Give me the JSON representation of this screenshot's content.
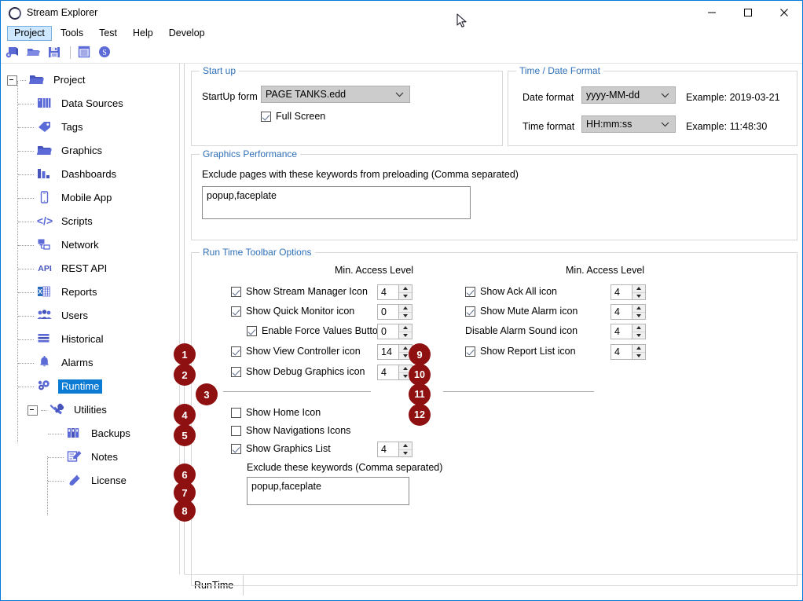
{
  "window": {
    "title": "Stream Explorer",
    "icon": "app-ring-icon",
    "minimize": "─",
    "maximize": "□",
    "close": "✕"
  },
  "menubar": {
    "items": [
      {
        "label": "Project",
        "active": true
      },
      {
        "label": "Tools",
        "active": false
      },
      {
        "label": "Test",
        "active": false
      },
      {
        "label": "Help",
        "active": false
      },
      {
        "label": "Develop",
        "active": false
      }
    ]
  },
  "toolbar": {
    "icons": [
      "new-project-icon",
      "open-folder-icon",
      "save-disk-icon",
      "separator",
      "list-view-icon",
      "s-circle-icon"
    ]
  },
  "sidebar": {
    "items": [
      {
        "label": "Project",
        "icon": "folder-icon",
        "level": 0,
        "expander": true,
        "selected": false
      },
      {
        "label": "Data Sources",
        "icon": "database-icon",
        "level": 1,
        "expander": false,
        "selected": false
      },
      {
        "label": "Tags",
        "icon": "tag-icon",
        "level": 1,
        "expander": false,
        "selected": false
      },
      {
        "label": "Graphics",
        "icon": "folder-icon",
        "level": 1,
        "expander": false,
        "selected": false
      },
      {
        "label": "Dashboards",
        "icon": "bar-chart-icon",
        "level": 1,
        "expander": false,
        "selected": false
      },
      {
        "label": "Mobile App",
        "icon": "phone-icon",
        "level": 1,
        "expander": false,
        "selected": false
      },
      {
        "label": "Scripts",
        "icon": "code-brackets-icon",
        "level": 1,
        "expander": false,
        "selected": false
      },
      {
        "label": "Network",
        "icon": "network-icon",
        "level": 1,
        "expander": false,
        "selected": false
      },
      {
        "label": "REST API",
        "icon": "api-text-icon",
        "level": 1,
        "expander": false,
        "selected": false
      },
      {
        "label": "Reports",
        "icon": "excel-icon",
        "level": 1,
        "expander": false,
        "selected": false
      },
      {
        "label": "Users",
        "icon": "users-icon",
        "level": 1,
        "expander": false,
        "selected": false
      },
      {
        "label": "Historical",
        "icon": "history-lines-icon",
        "level": 1,
        "expander": false,
        "selected": false
      },
      {
        "label": "Alarms",
        "icon": "bell-icon",
        "level": 1,
        "expander": false,
        "selected": false
      },
      {
        "label": "Runtime",
        "icon": "gears-icon",
        "level": 1,
        "expander": false,
        "selected": true
      },
      {
        "label": "Utilities",
        "icon": "tools-icon",
        "level": 1,
        "expander": true,
        "selected": false
      },
      {
        "label": "Backups",
        "icon": "backups-icon",
        "level": 2,
        "expander": false,
        "selected": false
      },
      {
        "label": "Notes",
        "icon": "notes-icon",
        "level": 2,
        "expander": false,
        "selected": false
      },
      {
        "label": "License",
        "icon": "key-icon",
        "level": 2,
        "expander": false,
        "selected": false
      }
    ]
  },
  "startup": {
    "legend": "Start up",
    "form_label": "StartUp form",
    "form_value": "PAGE TANKS.edd",
    "fullscreen_label": "Full Screen",
    "fullscreen_checked": true
  },
  "datetime": {
    "legend": "Time / Date Format",
    "date_label": "Date format",
    "date_value": "yyyy-MM-dd",
    "date_example": "Example: 2019-03-21",
    "time_label": "Time format",
    "time_value": "HH:mm:ss",
    "time_example": "Example: 11:48:30"
  },
  "graphics_performance": {
    "legend": "Graphics Performance",
    "description": "Exclude pages with these keywords from preloading (Comma separated)",
    "keywords_value": "popup,faceplate"
  },
  "runtime_toolbar": {
    "legend": "Run Time Toolbar Options",
    "access_header_left": "Min. Access Level",
    "access_header_right": "Min. Access Level",
    "left_items": [
      {
        "badge": "1",
        "label": "Show Stream Manager Icon",
        "checked": true,
        "has_box": true,
        "access": "4"
      },
      {
        "badge": "2",
        "label": "Show Quick Monitor icon",
        "checked": true,
        "has_box": true,
        "access": "0"
      },
      {
        "badge": "3",
        "label": "Enable Force Values Button",
        "checked": true,
        "has_box": true,
        "access": "0"
      },
      {
        "badge": "4",
        "label": "Show View Controller icon",
        "checked": true,
        "has_box": true,
        "access": "14"
      },
      {
        "badge": "5",
        "label": "Show Debug Graphics icon",
        "checked": true,
        "has_box": true,
        "access": "4"
      }
    ],
    "left_items_2": [
      {
        "badge": "6",
        "label": "Show Home Icon",
        "checked": false,
        "has_box": true,
        "access": null
      },
      {
        "badge": "7",
        "label": "Show Navigations Icons",
        "checked": false,
        "has_box": true,
        "access": null
      },
      {
        "badge": "8",
        "label": "Show Graphics List",
        "checked": true,
        "has_box": true,
        "access": "4"
      }
    ],
    "exclude_label": "Exclude these keywords (Comma separated)",
    "exclude_value": "popup,faceplate",
    "right_items": [
      {
        "badge": "9",
        "label": "Show Ack All icon",
        "checked": true,
        "has_box": true,
        "access": "4"
      },
      {
        "badge": "10",
        "label": "Show Mute Alarm icon",
        "checked": true,
        "has_box": true,
        "access": "4"
      },
      {
        "badge": "11",
        "label": "Disable Alarm Sound icon",
        "checked": true,
        "has_box": false,
        "access": "4"
      },
      {
        "badge": "12",
        "label": "Show Report List icon",
        "checked": true,
        "has_box": true,
        "access": "4"
      }
    ]
  },
  "tabs": {
    "items": [
      {
        "label": "RunTime",
        "active": true
      }
    ]
  },
  "colors": {
    "accent": "#0078d7",
    "badge": "#8e1010",
    "legend": "#2e6fb7",
    "selection": "#0c7bd4",
    "icon_blue": "#5b6ad6"
  }
}
